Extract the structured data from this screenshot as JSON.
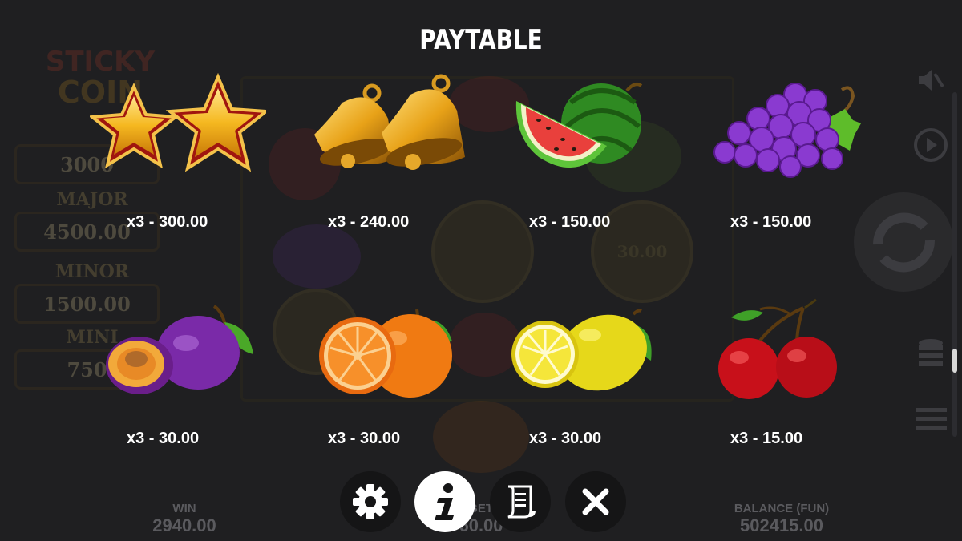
{
  "title": "PAYTABLE",
  "background": {
    "logo_text": "STICKY COIN",
    "jackpots": [
      {
        "label": "MAJOR",
        "value": "4500.00"
      },
      {
        "label": "MINOR",
        "value": "1500.00"
      },
      {
        "label": "MINI",
        "value": "750"
      }
    ],
    "win_label": "WIN",
    "win_value": "2940.00",
    "bet_label": "BET",
    "bet_value": "60.00",
    "balance_label": "BALANCE (FUN)",
    "balance_value": "502415.00",
    "coin_value": "30.00"
  },
  "paytable": [
    {
      "symbol": "stars",
      "payout": "x3 - 300.00"
    },
    {
      "symbol": "bells",
      "payout": "x3 - 240.00"
    },
    {
      "symbol": "watermelon",
      "payout": "x3 - 150.00"
    },
    {
      "symbol": "grapes",
      "payout": "x3 - 150.00"
    },
    {
      "symbol": "plum",
      "payout": "x3 - 30.00"
    },
    {
      "symbol": "orange",
      "payout": "x3 - 30.00"
    },
    {
      "symbol": "lemon",
      "payout": "x3 - 30.00"
    },
    {
      "symbol": "cherries",
      "payout": "x3 - 15.00"
    }
  ],
  "nav": [
    {
      "icon": "settings-gear-icon"
    },
    {
      "icon": "info-icon",
      "active": true
    },
    {
      "icon": "rules-scroll-icon"
    },
    {
      "icon": "close-icon"
    }
  ],
  "colors": {
    "background": "#1f1f21",
    "nav_button": "#151516",
    "active_nav": "#ffffff"
  }
}
